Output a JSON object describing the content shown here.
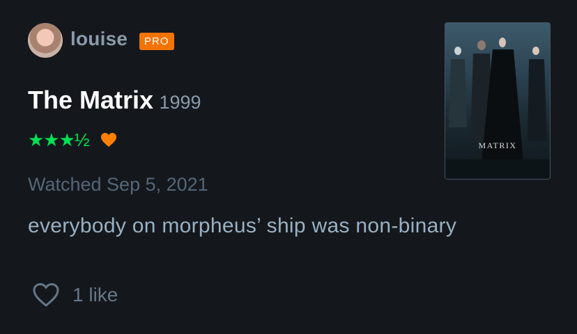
{
  "user": {
    "name": "louise",
    "badge": "PRO"
  },
  "film": {
    "title": "The Matrix",
    "year": "1999",
    "poster_text": "MATRIX"
  },
  "rating": {
    "stars": "★★★½",
    "value": 3.5,
    "liked": true
  },
  "watched": "Watched Sep 5, 2021",
  "review": "everybody on morpheus’ ship was non-binary",
  "likes": {
    "label": "1 like"
  },
  "colors": {
    "background": "#14181c",
    "star": "#00e054",
    "like": "#ff8000",
    "badge": "#f27405"
  }
}
